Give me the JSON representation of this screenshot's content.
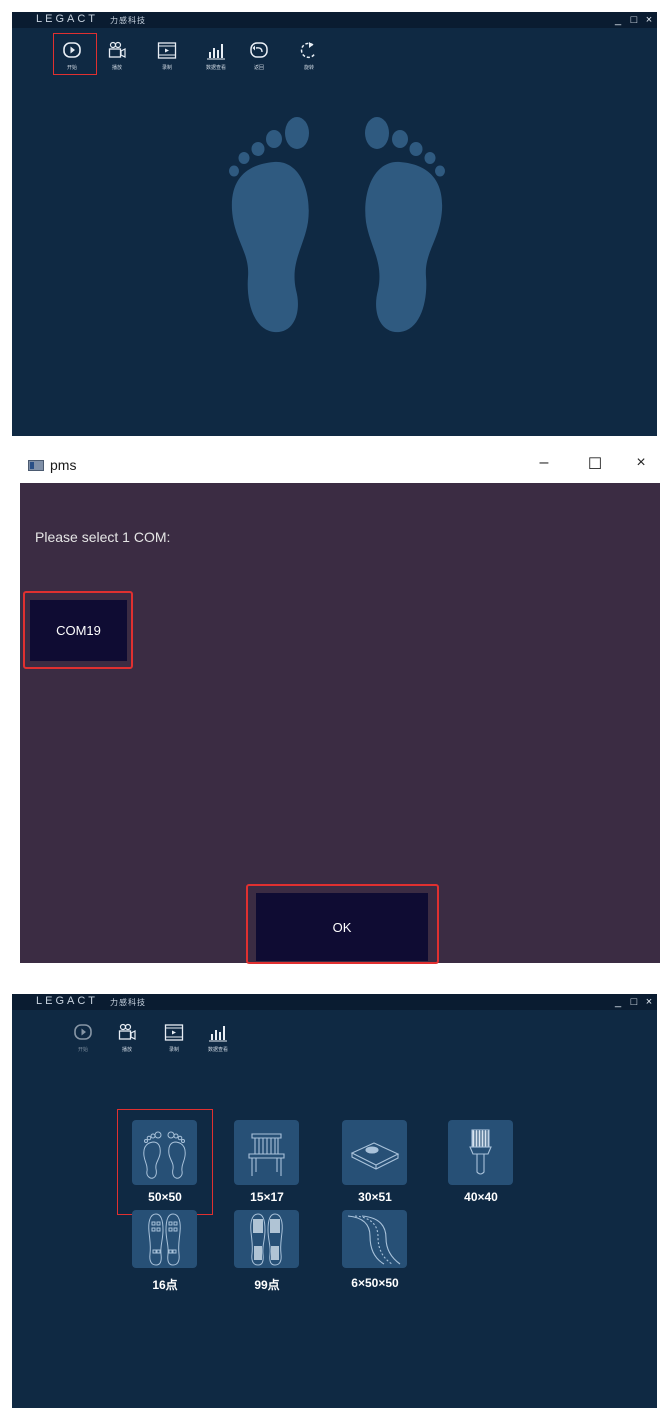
{
  "screen1": {
    "brand": "LEGACT",
    "brand_sub": "力感科技",
    "window_controls": {
      "minimize": "_",
      "maximize": "□",
      "close": "×"
    },
    "toolbar": [
      {
        "label": "开始",
        "icon": "play-circle-icon",
        "highlighted": true
      },
      {
        "label": "播放",
        "icon": "video-camera-icon"
      },
      {
        "label": "录制",
        "icon": "film-record-icon"
      },
      {
        "label": "数据查看",
        "icon": "bar-chart-icon"
      },
      {
        "label": "返回",
        "icon": "back-arrow-icon"
      },
      {
        "label": "旋转",
        "icon": "rotate-icon"
      }
    ],
    "illustration": "footprints-icon"
  },
  "screen2": {
    "window_title": "pms",
    "window_controls": {
      "minimize": "–",
      "maximize": "☐",
      "close": "×"
    },
    "prompt": "Please select 1 COM:",
    "com_option": "COM19",
    "ok_label": "OK",
    "highlight_color": "#e03030"
  },
  "screen3": {
    "brand": "LEGACT",
    "brand_sub": "力感科技",
    "window_controls": {
      "minimize": "_",
      "maximize": "□",
      "close": "×"
    },
    "toolbar": [
      {
        "label": "开始",
        "icon": "play-circle-icon"
      },
      {
        "label": "播放",
        "icon": "video-camera-icon"
      },
      {
        "label": "录制",
        "icon": "film-record-icon"
      },
      {
        "label": "数据查看",
        "icon": "bar-chart-icon"
      }
    ],
    "sensors": [
      {
        "label": "50×50",
        "icon": "footprints-icon",
        "highlighted": true
      },
      {
        "label": "15×17",
        "icon": "chair-icon"
      },
      {
        "label": "30×51",
        "icon": "cushion-icon"
      },
      {
        "label": "40×40",
        "icon": "brush-icon"
      },
      {
        "label": "16点",
        "icon": "insole-16-icon"
      },
      {
        "label": "99点",
        "icon": "insole-99-icon"
      },
      {
        "label": "6×50×50",
        "icon": "track-icon"
      }
    ]
  },
  "colors": {
    "app_bg": "#0f2943",
    "titlebar": "#0a1c31",
    "dialog_bg": "#3b2c43",
    "button_bg": "#0f0c33",
    "tile_bg": "#275076",
    "footprint": "#2f5a80",
    "highlight": "#e03030"
  }
}
